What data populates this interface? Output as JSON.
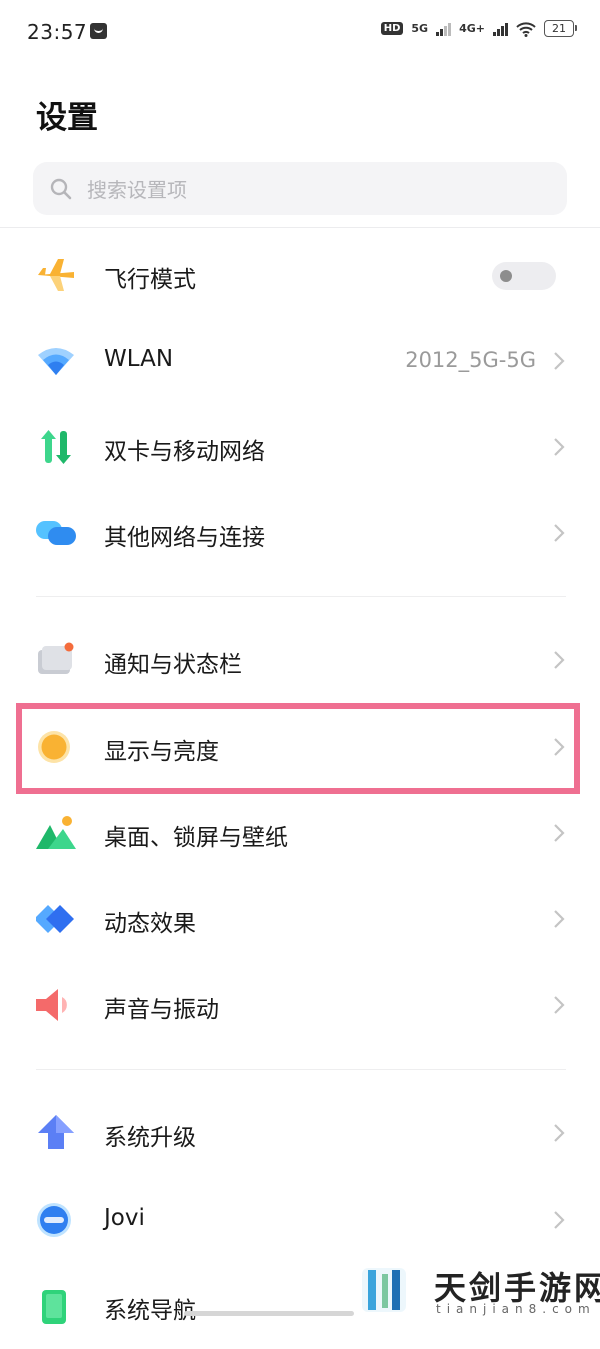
{
  "status_bar": {
    "time": "23:57",
    "hd_label": "HD",
    "sim1_label": "5G",
    "sim2_label": "4G+",
    "battery_level": "21"
  },
  "header": {
    "title": "设置"
  },
  "search": {
    "placeholder": "搜索设置项",
    "value": ""
  },
  "settings_items": [
    {
      "label": "飞行模式",
      "icon": "airplane-icon",
      "toggle_on": false
    },
    {
      "label": "WLAN",
      "icon": "wifi-icon",
      "value": "2012_5G-5G"
    },
    {
      "label": "双卡与移动网络",
      "icon": "dual-sim-icon"
    },
    {
      "label": "其他网络与连接",
      "icon": "connection-icon"
    },
    {
      "label": "通知与状态栏",
      "icon": "notification-icon"
    },
    {
      "label": "显示与亮度",
      "icon": "brightness-icon",
      "highlighted": true
    },
    {
      "label": "桌面、锁屏与壁纸",
      "icon": "wallpaper-icon"
    },
    {
      "label": "动态效果",
      "icon": "animation-icon"
    },
    {
      "label": "声音与振动",
      "icon": "speaker-icon"
    },
    {
      "label": "系统升级",
      "icon": "upgrade-icon"
    },
    {
      "label": "Jovi",
      "icon": "jovi-icon"
    },
    {
      "label": "系统导航",
      "icon": "navigation-icon"
    }
  ],
  "colors": {
    "highlight": "#ef6f91",
    "accent_blue": "#2f8cf0",
    "accent_orange": "#f9b233"
  },
  "watermark": {
    "brand": "天剑手游网",
    "url": "tianjian8.com"
  }
}
